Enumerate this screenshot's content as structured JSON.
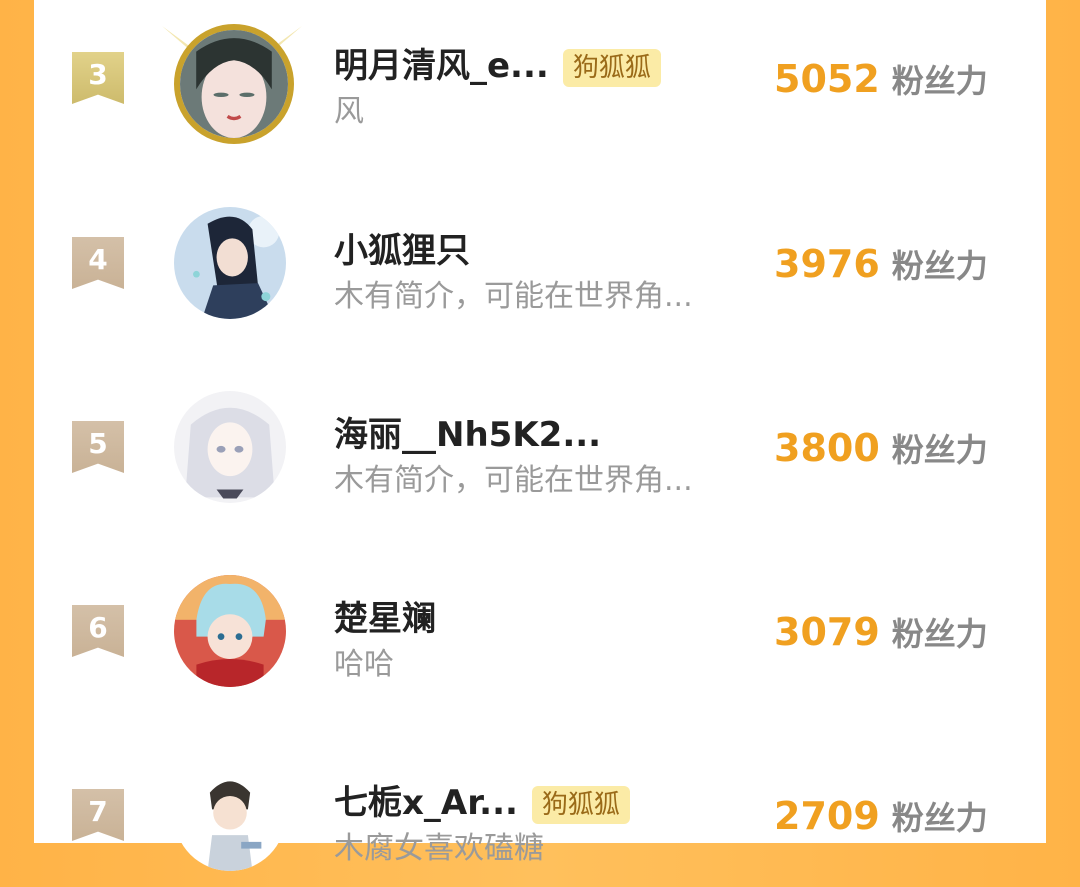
{
  "rows": [
    {
      "rank": "3",
      "name": "明月清风_e...",
      "tag": "狗狐狐",
      "bio": "风",
      "score": "5052",
      "unit": "粉丝力"
    },
    {
      "rank": "4",
      "name": "小狐狸只",
      "tag": "",
      "bio": "木有简介，可能在世界角...",
      "score": "3976",
      "unit": "粉丝力"
    },
    {
      "rank": "5",
      "name": "海丽__Nh5K2...",
      "tag": "",
      "bio": "木有简介，可能在世界角...",
      "score": "3800",
      "unit": "粉丝力"
    },
    {
      "rank": "6",
      "name": "楚星斓",
      "tag": "",
      "bio": "哈哈",
      "score": "3079",
      "unit": "粉丝力"
    },
    {
      "rank": "7",
      "name": "七栀x_Ar...",
      "tag": "狗狐狐",
      "bio": "木腐女喜欢磕糖",
      "score": "2709",
      "unit": "粉丝力"
    }
  ]
}
